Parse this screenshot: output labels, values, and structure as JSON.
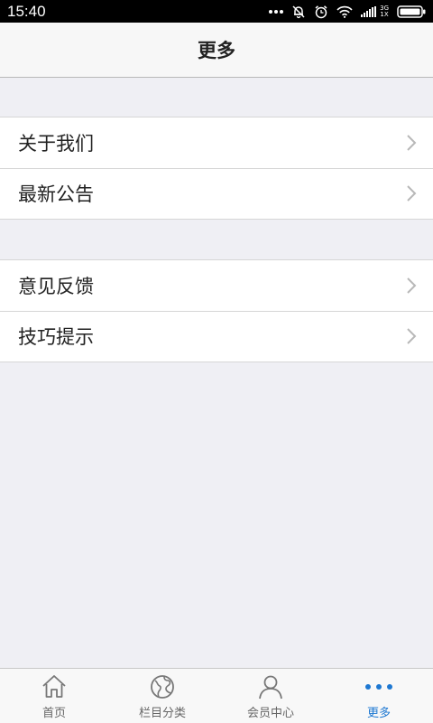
{
  "status_bar": {
    "time": "15:40",
    "network_top": "3G",
    "network_bottom": "1X"
  },
  "nav": {
    "title": "更多"
  },
  "groups": [
    {
      "items": [
        {
          "label": "关于我们"
        },
        {
          "label": "最新公告"
        }
      ]
    },
    {
      "items": [
        {
          "label": "意见反馈"
        },
        {
          "label": "技巧提示"
        }
      ]
    }
  ],
  "tabs": [
    {
      "label": "首页",
      "icon": "home-icon",
      "active": false
    },
    {
      "label": "栏目分类",
      "icon": "globe-icon",
      "active": false
    },
    {
      "label": "会员中心",
      "icon": "user-icon",
      "active": false
    },
    {
      "label": "更多",
      "icon": "more-dots-icon",
      "active": true
    }
  ],
  "colors": {
    "accent": "#1e78d2",
    "background": "#efeff4",
    "status_bar": "#000000"
  }
}
